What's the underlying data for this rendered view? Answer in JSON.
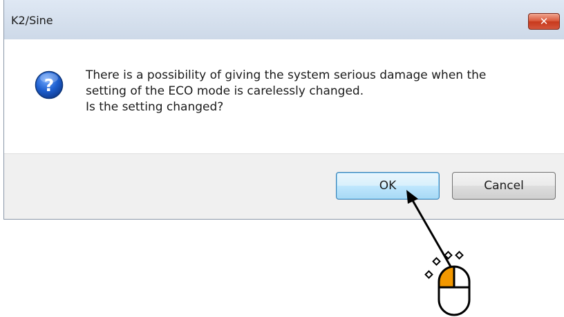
{
  "window": {
    "title": "K2/Sine",
    "close_label": "✕"
  },
  "message": {
    "icon": "question-icon",
    "lines": [
      "There is a possibility of giving the system serious damage when the",
      "setting of the ECO mode is carelessly changed.",
      "Is the setting changed?"
    ]
  },
  "buttons": {
    "ok_label": "OK",
    "cancel_label": "Cancel"
  },
  "annotation": {
    "pointer": "arrow-to-ok-button",
    "mouse_icon": "mouse-left-click-icon",
    "highlight_color": "#f39800"
  },
  "colors": {
    "titlebar": "#dfe8f4",
    "close_button": "#c7391c",
    "ok_border": "#3c7fb1",
    "footer": "#f0f0f0"
  }
}
